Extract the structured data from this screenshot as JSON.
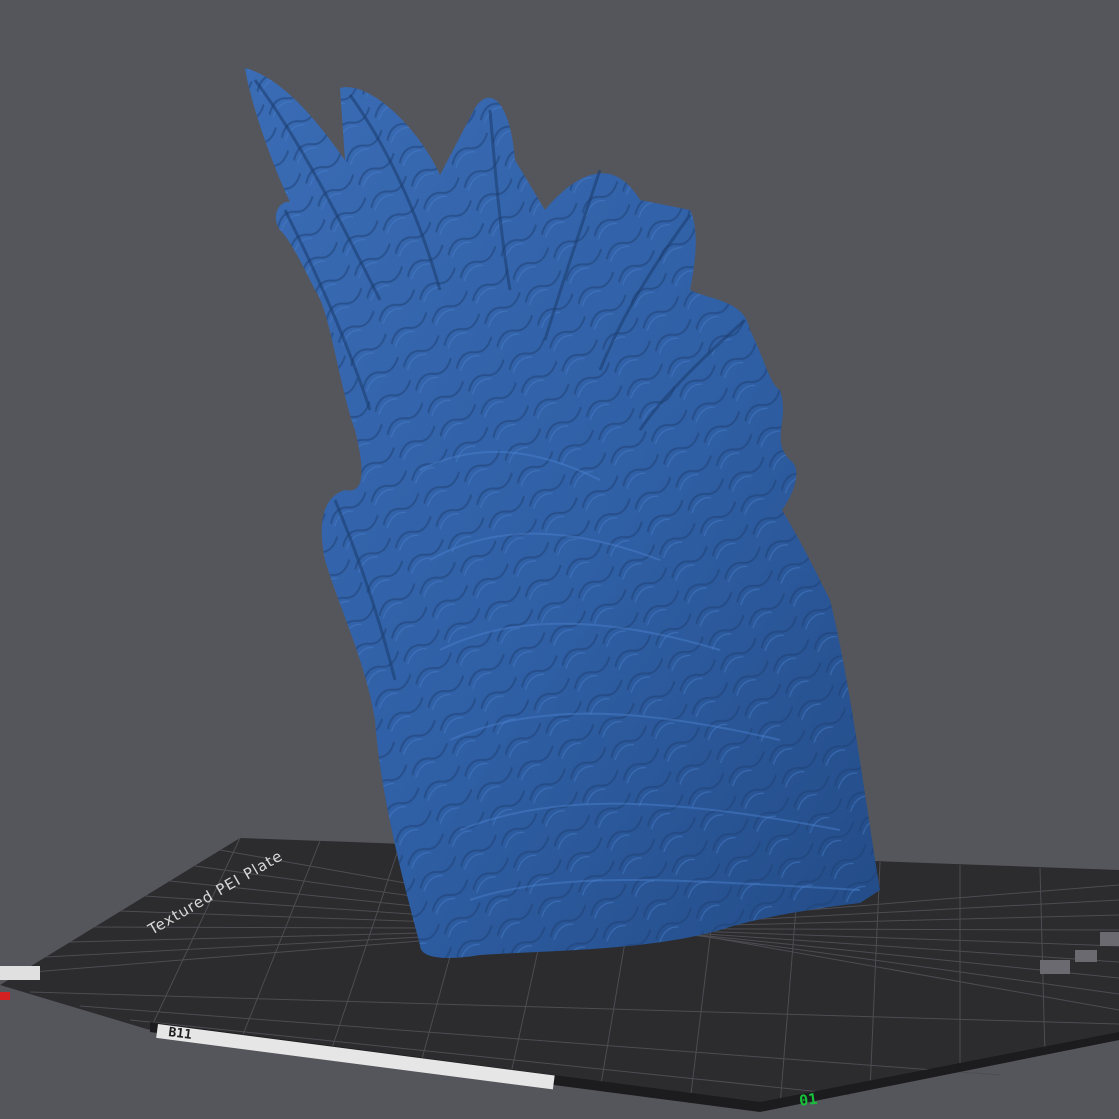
{
  "viewport": {
    "background_color": "#55555c",
    "model_color": "#2f5fa5"
  },
  "build_plate": {
    "label": "Textured PEI Plate",
    "code": "B11",
    "plate_number": "01",
    "origin_marker_color": "#d42020",
    "plate_number_color": "#16c23a"
  },
  "model": {
    "name": "feather-wing-model"
  }
}
